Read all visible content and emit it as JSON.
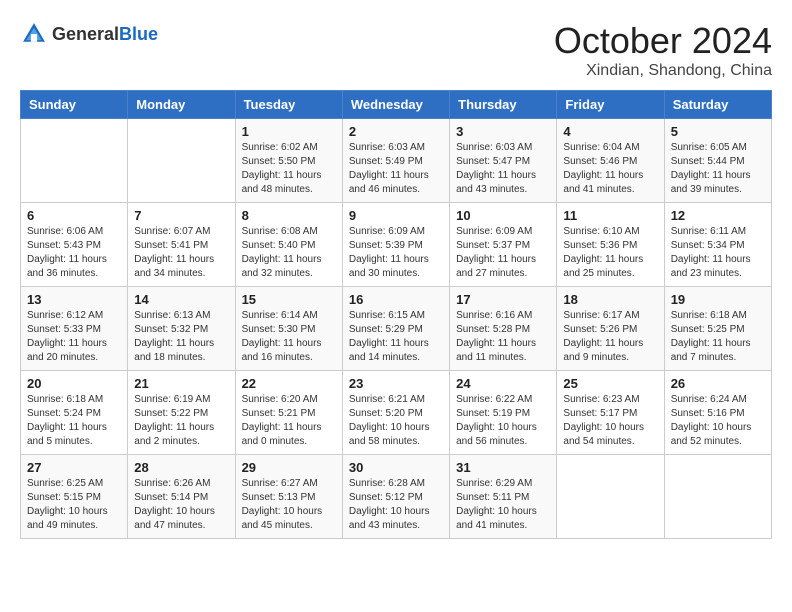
{
  "logo": {
    "general": "General",
    "blue": "Blue"
  },
  "title": "October 2024",
  "location": "Xindian, Shandong, China",
  "days_of_week": [
    "Sunday",
    "Monday",
    "Tuesday",
    "Wednesday",
    "Thursday",
    "Friday",
    "Saturday"
  ],
  "weeks": [
    [
      null,
      null,
      {
        "day": 1,
        "sunrise": "6:02 AM",
        "sunset": "5:50 PM",
        "daylight": "11 hours and 48 minutes."
      },
      {
        "day": 2,
        "sunrise": "6:03 AM",
        "sunset": "5:49 PM",
        "daylight": "11 hours and 46 minutes."
      },
      {
        "day": 3,
        "sunrise": "6:03 AM",
        "sunset": "5:47 PM",
        "daylight": "11 hours and 43 minutes."
      },
      {
        "day": 4,
        "sunrise": "6:04 AM",
        "sunset": "5:46 PM",
        "daylight": "11 hours and 41 minutes."
      },
      {
        "day": 5,
        "sunrise": "6:05 AM",
        "sunset": "5:44 PM",
        "daylight": "11 hours and 39 minutes."
      }
    ],
    [
      {
        "day": 6,
        "sunrise": "6:06 AM",
        "sunset": "5:43 PM",
        "daylight": "11 hours and 36 minutes."
      },
      {
        "day": 7,
        "sunrise": "6:07 AM",
        "sunset": "5:41 PM",
        "daylight": "11 hours and 34 minutes."
      },
      {
        "day": 8,
        "sunrise": "6:08 AM",
        "sunset": "5:40 PM",
        "daylight": "11 hours and 32 minutes."
      },
      {
        "day": 9,
        "sunrise": "6:09 AM",
        "sunset": "5:39 PM",
        "daylight": "11 hours and 30 minutes."
      },
      {
        "day": 10,
        "sunrise": "6:09 AM",
        "sunset": "5:37 PM",
        "daylight": "11 hours and 27 minutes."
      },
      {
        "day": 11,
        "sunrise": "6:10 AM",
        "sunset": "5:36 PM",
        "daylight": "11 hours and 25 minutes."
      },
      {
        "day": 12,
        "sunrise": "6:11 AM",
        "sunset": "5:34 PM",
        "daylight": "11 hours and 23 minutes."
      }
    ],
    [
      {
        "day": 13,
        "sunrise": "6:12 AM",
        "sunset": "5:33 PM",
        "daylight": "11 hours and 20 minutes."
      },
      {
        "day": 14,
        "sunrise": "6:13 AM",
        "sunset": "5:32 PM",
        "daylight": "11 hours and 18 minutes."
      },
      {
        "day": 15,
        "sunrise": "6:14 AM",
        "sunset": "5:30 PM",
        "daylight": "11 hours and 16 minutes."
      },
      {
        "day": 16,
        "sunrise": "6:15 AM",
        "sunset": "5:29 PM",
        "daylight": "11 hours and 14 minutes."
      },
      {
        "day": 17,
        "sunrise": "6:16 AM",
        "sunset": "5:28 PM",
        "daylight": "11 hours and 11 minutes."
      },
      {
        "day": 18,
        "sunrise": "6:17 AM",
        "sunset": "5:26 PM",
        "daylight": "11 hours and 9 minutes."
      },
      {
        "day": 19,
        "sunrise": "6:18 AM",
        "sunset": "5:25 PM",
        "daylight": "11 hours and 7 minutes."
      }
    ],
    [
      {
        "day": 20,
        "sunrise": "6:18 AM",
        "sunset": "5:24 PM",
        "daylight": "11 hours and 5 minutes."
      },
      {
        "day": 21,
        "sunrise": "6:19 AM",
        "sunset": "5:22 PM",
        "daylight": "11 hours and 2 minutes."
      },
      {
        "day": 22,
        "sunrise": "6:20 AM",
        "sunset": "5:21 PM",
        "daylight": "11 hours and 0 minutes."
      },
      {
        "day": 23,
        "sunrise": "6:21 AM",
        "sunset": "5:20 PM",
        "daylight": "10 hours and 58 minutes."
      },
      {
        "day": 24,
        "sunrise": "6:22 AM",
        "sunset": "5:19 PM",
        "daylight": "10 hours and 56 minutes."
      },
      {
        "day": 25,
        "sunrise": "6:23 AM",
        "sunset": "5:17 PM",
        "daylight": "10 hours and 54 minutes."
      },
      {
        "day": 26,
        "sunrise": "6:24 AM",
        "sunset": "5:16 PM",
        "daylight": "10 hours and 52 minutes."
      }
    ],
    [
      {
        "day": 27,
        "sunrise": "6:25 AM",
        "sunset": "5:15 PM",
        "daylight": "10 hours and 49 minutes."
      },
      {
        "day": 28,
        "sunrise": "6:26 AM",
        "sunset": "5:14 PM",
        "daylight": "10 hours and 47 minutes."
      },
      {
        "day": 29,
        "sunrise": "6:27 AM",
        "sunset": "5:13 PM",
        "daylight": "10 hours and 45 minutes."
      },
      {
        "day": 30,
        "sunrise": "6:28 AM",
        "sunset": "5:12 PM",
        "daylight": "10 hours and 43 minutes."
      },
      {
        "day": 31,
        "sunrise": "6:29 AM",
        "sunset": "5:11 PM",
        "daylight": "10 hours and 41 minutes."
      },
      null,
      null
    ]
  ]
}
